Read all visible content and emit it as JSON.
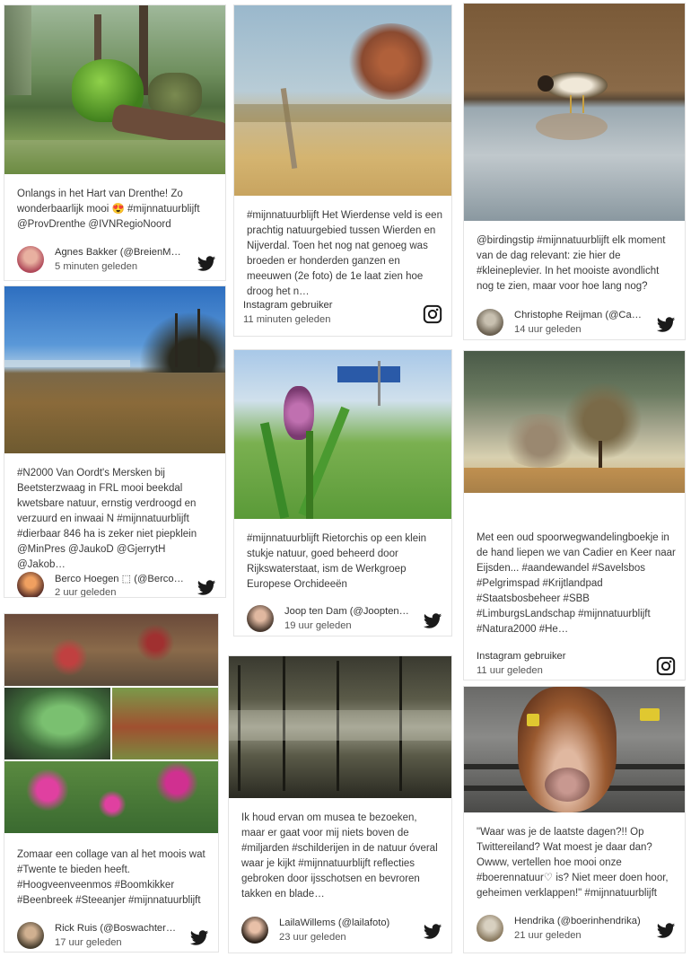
{
  "posts": [
    {
      "text": "Onlangs in het Hart van Drenthe! Zo wonderbaarlijk mooi 😍 #mijnnatuurblijft @ProvDrenthe @IVNRegioNoord",
      "user": "Agnes Bakker (@BreienMetAg…",
      "time": "5 minuten geleden",
      "network": "twitter-icon"
    },
    {
      "text": "#mijnnatuurblijft Het Wierdense veld is een prachtig natuurgebied tussen Wierden en Nijverdal. Toen het nog nat genoeg was broeden er honderden ganzen en meeuwen (2e foto) de 1e laat zien hoe droog het n…",
      "user": "Instagram gebruiker",
      "time": "11 minuten geleden",
      "network": "instagram-icon"
    },
    {
      "text": "@birdingstip #mijnnatuurblijft elk moment van de dag relevant: zie hier de #kleineplevier. In het mooiste avondlicht nog te zien, maar voor hoe lang nog?",
      "user": "Christophe Reijman (@Carro…",
      "time": "14 uur geleden",
      "network": "twitter-icon"
    },
    {
      "text": "#N2000 Van Oordt's Mersken bij Beetsterzwaag in FRL mooi beekdal kwetsbare natuur, ernstig verdroogd en verzuurd en inwaai N #mijnnatuurblijft #dierbaar 846 ha is zeker niet piepklein @MinPres @JaukoD @GjerrytH @Jakob…",
      "user": "Berco Hoegen ⬚ (@BercoHoe…",
      "time": "2 uur geleden",
      "network": "twitter-icon"
    },
    {
      "text": "#mijnnatuurblijft Rietorchis op een klein stukje natuur, goed beheerd door Rijkswaterstaat, ism de Werkgroep Europese Orchideeën",
      "user": "Joop ten Dam (@JooptenDam)",
      "time": "19 uur geleden",
      "network": "twitter-icon"
    },
    {
      "text": "Met een oud spoorwegwandelingboekje in de hand liepen we van Cadier en Keer naar Eijsden... #aandewandel #Savelsbos #Pelgrimspad #Krijtlandpad #Staatsbosbeheer #SBB #LimburgsLandschap #mijnnatuurblijft #Natura2000 #He…",
      "user": "Instagram gebruiker",
      "time": "11 uur geleden",
      "network": "instagram-icon"
    },
    {
      "text": "Zomaar een collage van al het moois wat #Twente te bieden heeft. #Hoogveenveenmos #Boomkikker #Beenbreek #Steeanjer #mijnnatuurblijft",
      "user": "Rick Ruis (@BoswachterRick)",
      "time": "17 uur geleden",
      "network": "twitter-icon"
    },
    {
      "text": "Ik houd ervan om musea te bezoeken, maar er gaat voor mij niets boven de #miljarden #schilderijen in de natuur óveral waar je kijkt #mijnnatuurblijft reflecties gebroken door ijsschotsen en bevroren takken en blade…",
      "user": "LailaWillems (@lailafoto)",
      "time": "23 uur geleden",
      "network": "twitter-icon"
    },
    {
      "text": "\"Waar was je de laatste dagen?!! Op Twittereiland? Wat moest je daar dan? Owww, vertellen hoe mooi onze #boerennatuur♡ is? Niet meer doen hoor, geheimen verklappen!\" #mijnnatuurblijft",
      "user": "Hendrika (@boerinhendrika)",
      "time": "21 uur geleden",
      "network": "twitter-icon"
    }
  ],
  "colors": {
    "twitter": "#1a1a1a",
    "instagram": "#1a1a1a",
    "accent": "#2aa198"
  }
}
